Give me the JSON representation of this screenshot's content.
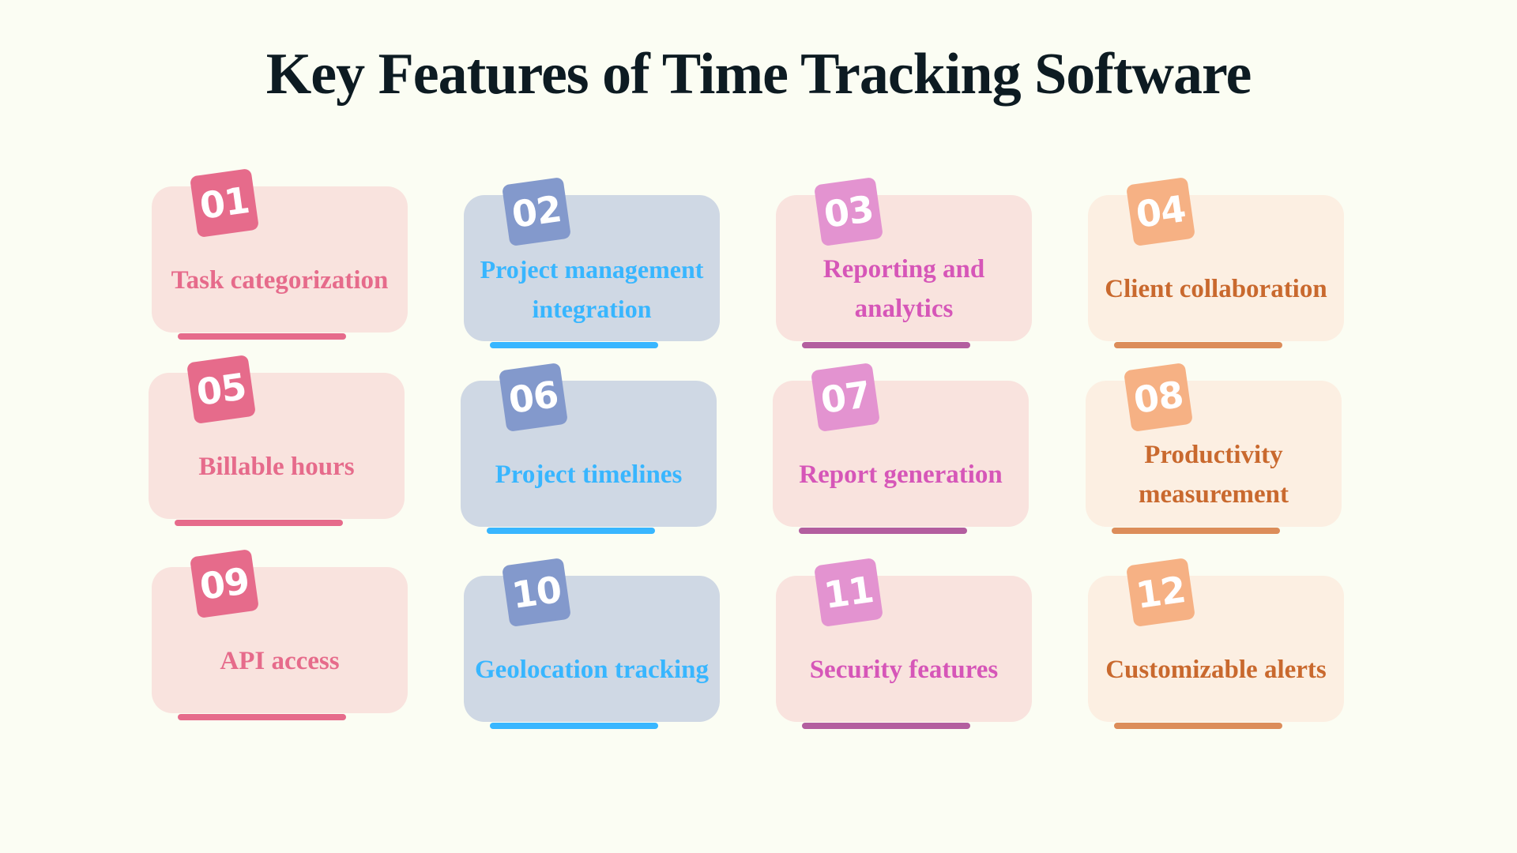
{
  "title": "Key Features of Time Tracking Software",
  "colors": {
    "background": "#fbfdf3",
    "title": "#0d1b22",
    "pink": {
      "card": "#f9e3de",
      "badge": "#e66b8b",
      "text": "#e66b8b",
      "bar": "#e66b8b"
    },
    "blue": {
      "card": "#cfd8e4",
      "badge": "#8399cc",
      "text": "#38b6ff",
      "bar": "#38b6ff"
    },
    "magenta": {
      "card": "#f9e3de",
      "badge": "#e393d0",
      "text": "#d656b8",
      "bar": "#b35e9f"
    },
    "orange": {
      "card": "#fcefe2",
      "badge": "#f6b184",
      "text": "#c9692e",
      "bar": "#dc8d5a"
    }
  },
  "features": [
    {
      "number": "01",
      "label": "Task categorization",
      "theme": "pink"
    },
    {
      "number": "02",
      "label": "Project management integration",
      "theme": "blue"
    },
    {
      "number": "03",
      "label": "Reporting and analytics",
      "theme": "magenta"
    },
    {
      "number": "04",
      "label": "Client collaboration",
      "theme": "orange"
    },
    {
      "number": "05",
      "label": "Billable hours",
      "theme": "pink"
    },
    {
      "number": "06",
      "label": "Project timelines",
      "theme": "blue"
    },
    {
      "number": "07",
      "label": "Report generation",
      "theme": "magenta"
    },
    {
      "number": "08",
      "label": "Productivity measurement",
      "theme": "orange"
    },
    {
      "number": "09",
      "label": "API access",
      "theme": "pink"
    },
    {
      "number": "10",
      "label": "Geolocation tracking",
      "theme": "blue"
    },
    {
      "number": "11",
      "label": "Security features",
      "theme": "magenta"
    },
    {
      "number": "12",
      "label": "Customizable alerts",
      "theme": "orange"
    }
  ]
}
